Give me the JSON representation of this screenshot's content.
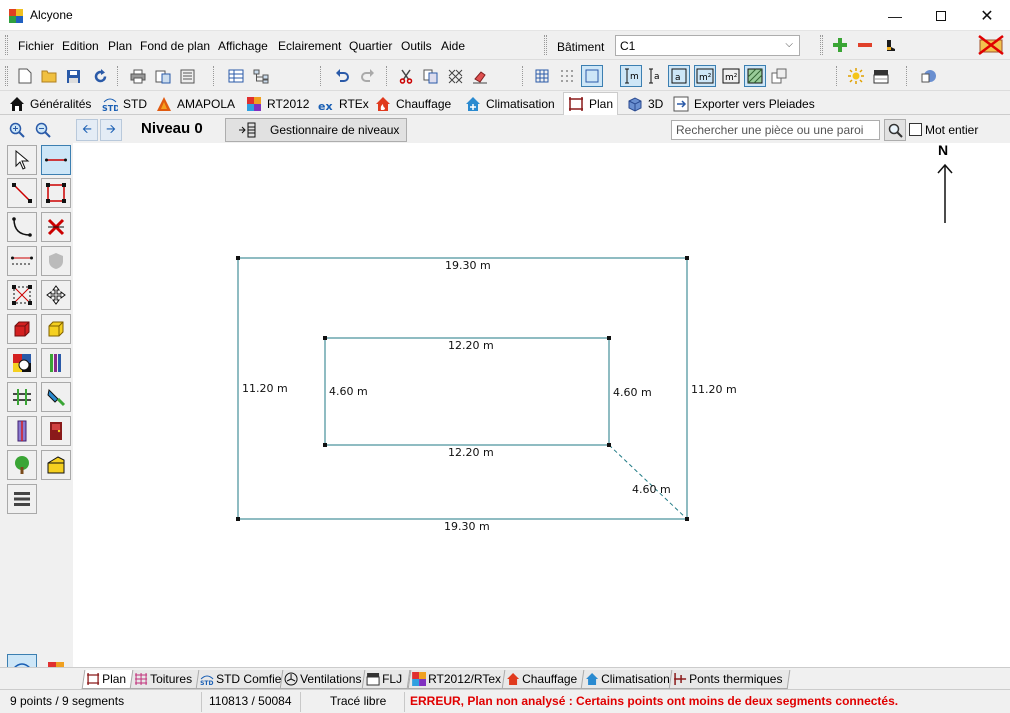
{
  "window": {
    "title": "Alcyone"
  },
  "menu": {
    "items": [
      "Fichier",
      "Edition",
      "Plan",
      "Fond de plan",
      "Affichage",
      "Eclairement",
      "Quartier",
      "Outils",
      "Aide"
    ]
  },
  "batiment": {
    "label": "Bâtiment",
    "value": "C1"
  },
  "tabs": [
    {
      "label": "Généralités",
      "icon": "home-icon"
    },
    {
      "label": "STD",
      "icon": "std-icon"
    },
    {
      "label": "AMAPOLA",
      "icon": "amapola-icon"
    },
    {
      "label": "RT2012",
      "icon": "rt2012-icon"
    },
    {
      "label": "RTEx",
      "icon": "rtex-icon"
    },
    {
      "label": "Chauffage",
      "icon": "chauffage-icon"
    },
    {
      "label": "Climatisation",
      "icon": "climatisation-icon"
    },
    {
      "label": "Plan",
      "icon": "plan-icon"
    },
    {
      "label": "3D",
      "icon": "3d-icon"
    },
    {
      "label": "Exporter vers Pleiades",
      "icon": "export-icon"
    }
  ],
  "level": {
    "title": "Niveau 0",
    "manager_button": "Gestionnaire de niveaux",
    "search_placeholder": "Rechercher une pièce ou une paroi",
    "whole_word_label": "Mot entier"
  },
  "compass": {
    "label": "N"
  },
  "plan": {
    "dimensions": {
      "outer_top": "19.30 m",
      "outer_bottom": "19.30 m",
      "outer_left": "11.20 m",
      "outer_right": "11.20 m",
      "inner_top": "12.20 m",
      "inner_bottom": "12.20 m",
      "inner_left": "4.60 m",
      "inner_right": "4.60 m",
      "diagonal": "4.60 m"
    }
  },
  "bottom_tabs": [
    "Plan",
    "Toitures",
    "STD Comfie",
    "Ventilations",
    "FLJ",
    "RT2012/RTex",
    "Chauffage",
    "Climatisation",
    "Ponts thermiques"
  ],
  "status": {
    "counts": "9 points / 9 segments",
    "coords": "110813 / 50084",
    "mode": "Tracé libre",
    "error": "ERREUR, Plan non analysé : Certains points ont moins de deux segments connectés."
  },
  "colors": {
    "plan_line": "#1f7a85",
    "error_text": "#e00000",
    "accent": "#3c7fb1"
  }
}
